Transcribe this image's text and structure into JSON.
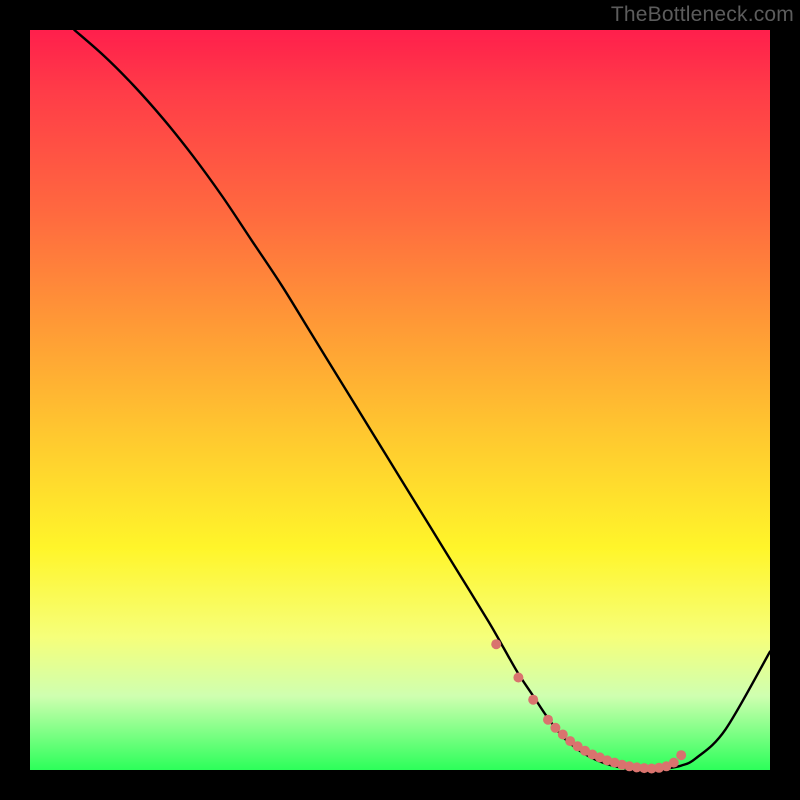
{
  "watermark": {
    "text": "TheBottleneck.com"
  },
  "colors": {
    "gradient_top": "#ff1f4c",
    "gradient_mid1": "#ff9a36",
    "gradient_mid2": "#fff52a",
    "gradient_bottom": "#2cff5a",
    "curve": "#000000",
    "dots": "#d9736e",
    "frame": "#000000"
  },
  "chart_data": {
    "type": "line",
    "title": "",
    "xlabel": "",
    "ylabel": "",
    "xlim": [
      0,
      100
    ],
    "ylim": [
      0,
      100
    ],
    "grid": false,
    "legend": false,
    "series": [
      {
        "name": "bottleneck-curve",
        "x": [
          6,
          10,
          14,
          18,
          22,
          26,
          30,
          34,
          38,
          42,
          46,
          50,
          54,
          58,
          62,
          64,
          66,
          68,
          70,
          72,
          74,
          76,
          78,
          80,
          82,
          84,
          86,
          88,
          90,
          94,
          100
        ],
        "y": [
          100,
          96.5,
          92.5,
          88,
          83,
          77.5,
          71.5,
          65.5,
          59,
          52.5,
          46,
          39.5,
          33,
          26.5,
          20,
          16.5,
          13,
          10,
          7,
          4.5,
          2.8,
          1.6,
          0.8,
          0.3,
          0,
          0,
          0.2,
          0.6,
          1.6,
          5.5,
          16
        ]
      }
    ],
    "highlight_points": {
      "name": "valley-dots",
      "x": [
        63,
        66,
        68,
        70,
        71,
        72,
        73,
        74,
        75,
        76,
        77,
        78,
        79,
        80,
        81,
        82,
        83,
        84,
        85,
        86,
        87,
        88
      ],
      "y": [
        17,
        12.5,
        9.5,
        6.8,
        5.7,
        4.8,
        3.9,
        3.2,
        2.6,
        2.1,
        1.7,
        1.3,
        1.0,
        0.7,
        0.5,
        0.35,
        0.25,
        0.2,
        0.3,
        0.5,
        1.0,
        2.0
      ]
    }
  }
}
